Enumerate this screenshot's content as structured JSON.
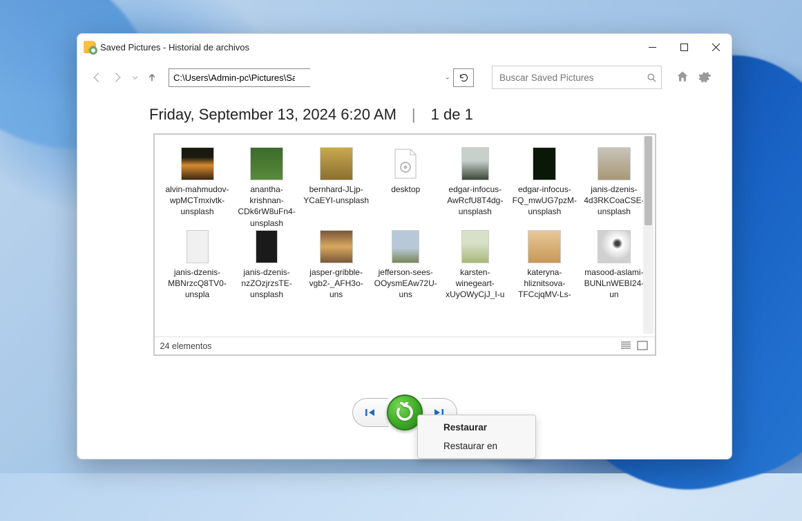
{
  "window": {
    "title": "Saved Pictures - Historial de archivos"
  },
  "toolbar": {
    "path": "C:\\Users\\Admin-pc\\Pictures\\Saved Pictures",
    "search_placeholder": "Buscar Saved Pictures"
  },
  "header": {
    "datetime": "Friday, September 13, 2024 6:20 AM",
    "page_indicator": "1 de 1"
  },
  "files": [
    {
      "name": "alvin-mahmudov-wpMCTmxivtk-unsplash",
      "thumb": "t-sunset"
    },
    {
      "name": "anantha-krishnan-CDk6rW8uFn4-unsplash",
      "thumb": "t-green"
    },
    {
      "name": "bernhard-JLjp-YCaEYI-unsplash",
      "thumb": "t-yellow"
    },
    {
      "name": "desktop",
      "thumb": "gear-file"
    },
    {
      "name": "edgar-infocus-AwRcfU8T4dg-unsplash",
      "thumb": "t-fog"
    },
    {
      "name": "edgar-infocus-FQ_mwUG7pzM-unsplash",
      "thumb": "t-dark-fern"
    },
    {
      "name": "janis-dzenis-4d3RKCoaCSE-unsplash",
      "thumb": "t-street"
    },
    {
      "name": "janis-dzenis-MBNrzcQ8TV0-unspla",
      "thumb": "t-white"
    },
    {
      "name": "janis-dzenis-nzZOzjrzsTE-unsplash",
      "thumb": "t-dark"
    },
    {
      "name": "jasper-gribble-vgb2-_AFH3o-uns",
      "thumb": "t-orange"
    },
    {
      "name": "jefferson-sees-OOysmEAw72U-uns",
      "thumb": "t-sky"
    },
    {
      "name": "karsten-winegeart-xUyOWyCjJ_I-u",
      "thumb": "t-grass"
    },
    {
      "name": "kateryna-hliznitsova-TFCcjqMV-Ls-",
      "thumb": "t-food"
    },
    {
      "name": "masood-aslami-BUNLnWEBI24-un",
      "thumb": "t-spiral"
    }
  ],
  "status": {
    "count_text": "24 elementos"
  },
  "context_menu": {
    "restore": "Restaurar",
    "restore_to": "Restaurar en"
  }
}
